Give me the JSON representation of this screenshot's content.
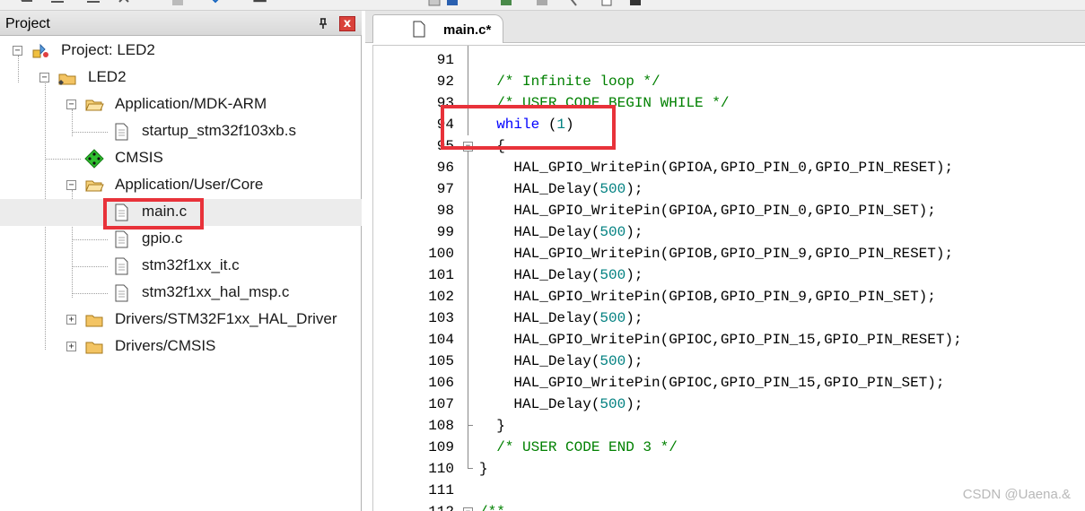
{
  "project_pane": {
    "title": "Project",
    "close_label": "x",
    "tree": [
      {
        "label": "Project: LED2",
        "icon": "project-icon",
        "expanded": true
      },
      {
        "label": "LED2",
        "icon": "target-folder-icon",
        "expanded": true
      },
      {
        "label": "Application/MDK-ARM",
        "icon": "folder-icon",
        "expanded": true
      },
      {
        "label": "startup_stm32f103xb.s",
        "icon": "file-icon"
      },
      {
        "label": "CMSIS",
        "icon": "cmsis-diamond-icon"
      },
      {
        "label": "Application/User/Core",
        "icon": "folder-icon",
        "expanded": true
      },
      {
        "label": "main.c",
        "icon": "file-icon",
        "selected": true
      },
      {
        "label": "gpio.c",
        "icon": "file-icon"
      },
      {
        "label": "stm32f1xx_it.c",
        "icon": "file-icon"
      },
      {
        "label": "stm32f1xx_hal_msp.c",
        "icon": "file-icon"
      },
      {
        "label": "Drivers/STM32F1xx_HAL_Driver",
        "icon": "folder-icon",
        "expanded": false
      },
      {
        "label": "Drivers/CMSIS",
        "icon": "folder-icon",
        "expanded": false
      }
    ]
  },
  "editor": {
    "active_tab": "main.c*",
    "lines": [
      {
        "num": "91",
        "segments": []
      },
      {
        "num": "92",
        "segments": [
          {
            "t": "  "
          },
          {
            "t": "/* Infinite loop */",
            "c": "comment"
          }
        ]
      },
      {
        "num": "93",
        "segments": [
          {
            "t": "  "
          },
          {
            "t": "/* USER CODE BEGIN WHILE */",
            "c": "comment"
          }
        ]
      },
      {
        "num": "94",
        "segments": [
          {
            "t": "  "
          },
          {
            "t": "while",
            "c": "keyword"
          },
          {
            "t": " ("
          },
          {
            "t": "1",
            "c": "number"
          },
          {
            "t": ")"
          }
        ]
      },
      {
        "num": "95",
        "segments": [
          {
            "t": "  {"
          }
        ]
      },
      {
        "num": "96",
        "segments": [
          {
            "t": "    HAL_GPIO_WritePin(GPIOA,GPIO_PIN_0,GPIO_PIN_RESET);"
          }
        ]
      },
      {
        "num": "97",
        "segments": [
          {
            "t": "    HAL_Delay("
          },
          {
            "t": "500",
            "c": "number"
          },
          {
            "t": ");"
          }
        ]
      },
      {
        "num": "98",
        "segments": [
          {
            "t": "    HAL_GPIO_WritePin(GPIOA,GPIO_PIN_0,GPIO_PIN_SET);"
          }
        ]
      },
      {
        "num": "99",
        "segments": [
          {
            "t": "    HAL_Delay("
          },
          {
            "t": "500",
            "c": "number"
          },
          {
            "t": ");"
          }
        ]
      },
      {
        "num": "100",
        "segments": [
          {
            "t": "    HAL_GPIO_WritePin(GPIOB,GPIO_PIN_9,GPIO_PIN_RESET);"
          }
        ]
      },
      {
        "num": "101",
        "segments": [
          {
            "t": "    HAL_Delay("
          },
          {
            "t": "500",
            "c": "number"
          },
          {
            "t": ");"
          }
        ]
      },
      {
        "num": "102",
        "segments": [
          {
            "t": "    HAL_GPIO_WritePin(GPIOB,GPIO_PIN_9,GPIO_PIN_SET);"
          }
        ]
      },
      {
        "num": "103",
        "segments": [
          {
            "t": "    HAL_Delay("
          },
          {
            "t": "500",
            "c": "number"
          },
          {
            "t": ");"
          }
        ]
      },
      {
        "num": "104",
        "segments": [
          {
            "t": "    HAL_GPIO_WritePin(GPIOC,GPIO_PIN_15,GPIO_PIN_RESET);"
          }
        ]
      },
      {
        "num": "105",
        "segments": [
          {
            "t": "    HAL_Delay("
          },
          {
            "t": "500",
            "c": "number"
          },
          {
            "t": ");"
          }
        ]
      },
      {
        "num": "106",
        "segments": [
          {
            "t": "    HAL_GPIO_WritePin(GPIOC,GPIO_PIN_15,GPIO_PIN_SET);"
          }
        ]
      },
      {
        "num": "107",
        "segments": [
          {
            "t": "    HAL_Delay("
          },
          {
            "t": "500",
            "c": "number"
          },
          {
            "t": ");"
          }
        ]
      },
      {
        "num": "108",
        "segments": [
          {
            "t": "  }"
          }
        ]
      },
      {
        "num": "109",
        "segments": [
          {
            "t": "  "
          },
          {
            "t": "/* USER CODE END 3 */",
            "c": "comment"
          }
        ]
      },
      {
        "num": "110",
        "segments": [
          {
            "t": "}"
          }
        ]
      },
      {
        "num": "111",
        "segments": []
      },
      {
        "num": "112",
        "segments": [
          {
            "t": "/**",
            "c": "comment"
          }
        ]
      }
    ]
  },
  "watermark": "CSDN @Uaena.&",
  "colors": {
    "highlight": "#e8323a",
    "comment": "#008000",
    "keyword": "#0000ff",
    "number": "#008080"
  }
}
